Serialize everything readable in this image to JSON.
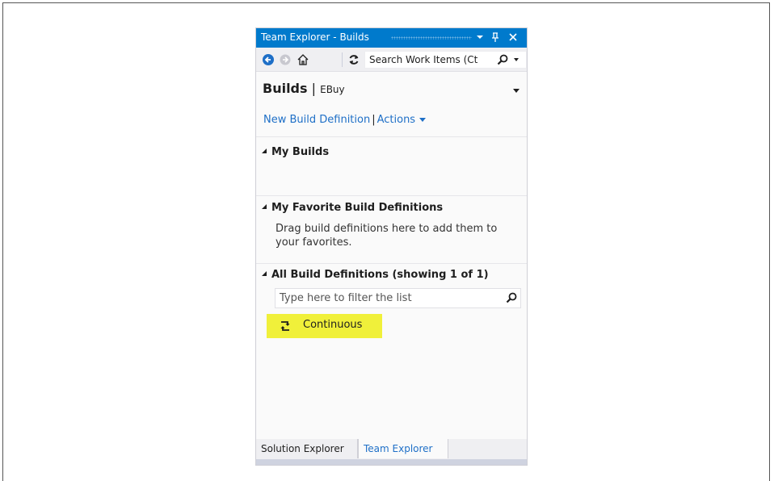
{
  "window": {
    "title": "Team Explorer - Builds",
    "pin_glyph": "0",
    "close_glyph": "✕"
  },
  "toolbar": {
    "back_icon": "back-arrow-icon",
    "forward_icon": "forward-arrow-icon",
    "home_icon": "home-icon",
    "refresh_icon": "refresh-icon",
    "search_placeholder": "Search Work Items (Ct"
  },
  "page": {
    "title": "Builds",
    "separator": "|",
    "subtitle": "EBuy"
  },
  "links": {
    "new_build_definition": "New Build Definition",
    "separator": "|",
    "actions": "Actions"
  },
  "sections": {
    "my_builds": "My Builds",
    "favorites": "My Favorite Build Definitions",
    "favorites_hint": "Drag build definitions here to add them to your favorites.",
    "all_definitions": "All Build Definitions (showing 1 of 1)",
    "filter_placeholder": "Type here to filter the list"
  },
  "build_definitions": [
    {
      "name": "Continuous",
      "icon": "continuous-build-icon",
      "highlight": "#f0f03a"
    }
  ],
  "bottom_tabs": {
    "solution_explorer": "Solution Explorer",
    "team_explorer": "Team Explorer"
  },
  "colors": {
    "title_bar": "#007acc",
    "link": "#1e6fc7",
    "highlight": "#f0f03a"
  }
}
